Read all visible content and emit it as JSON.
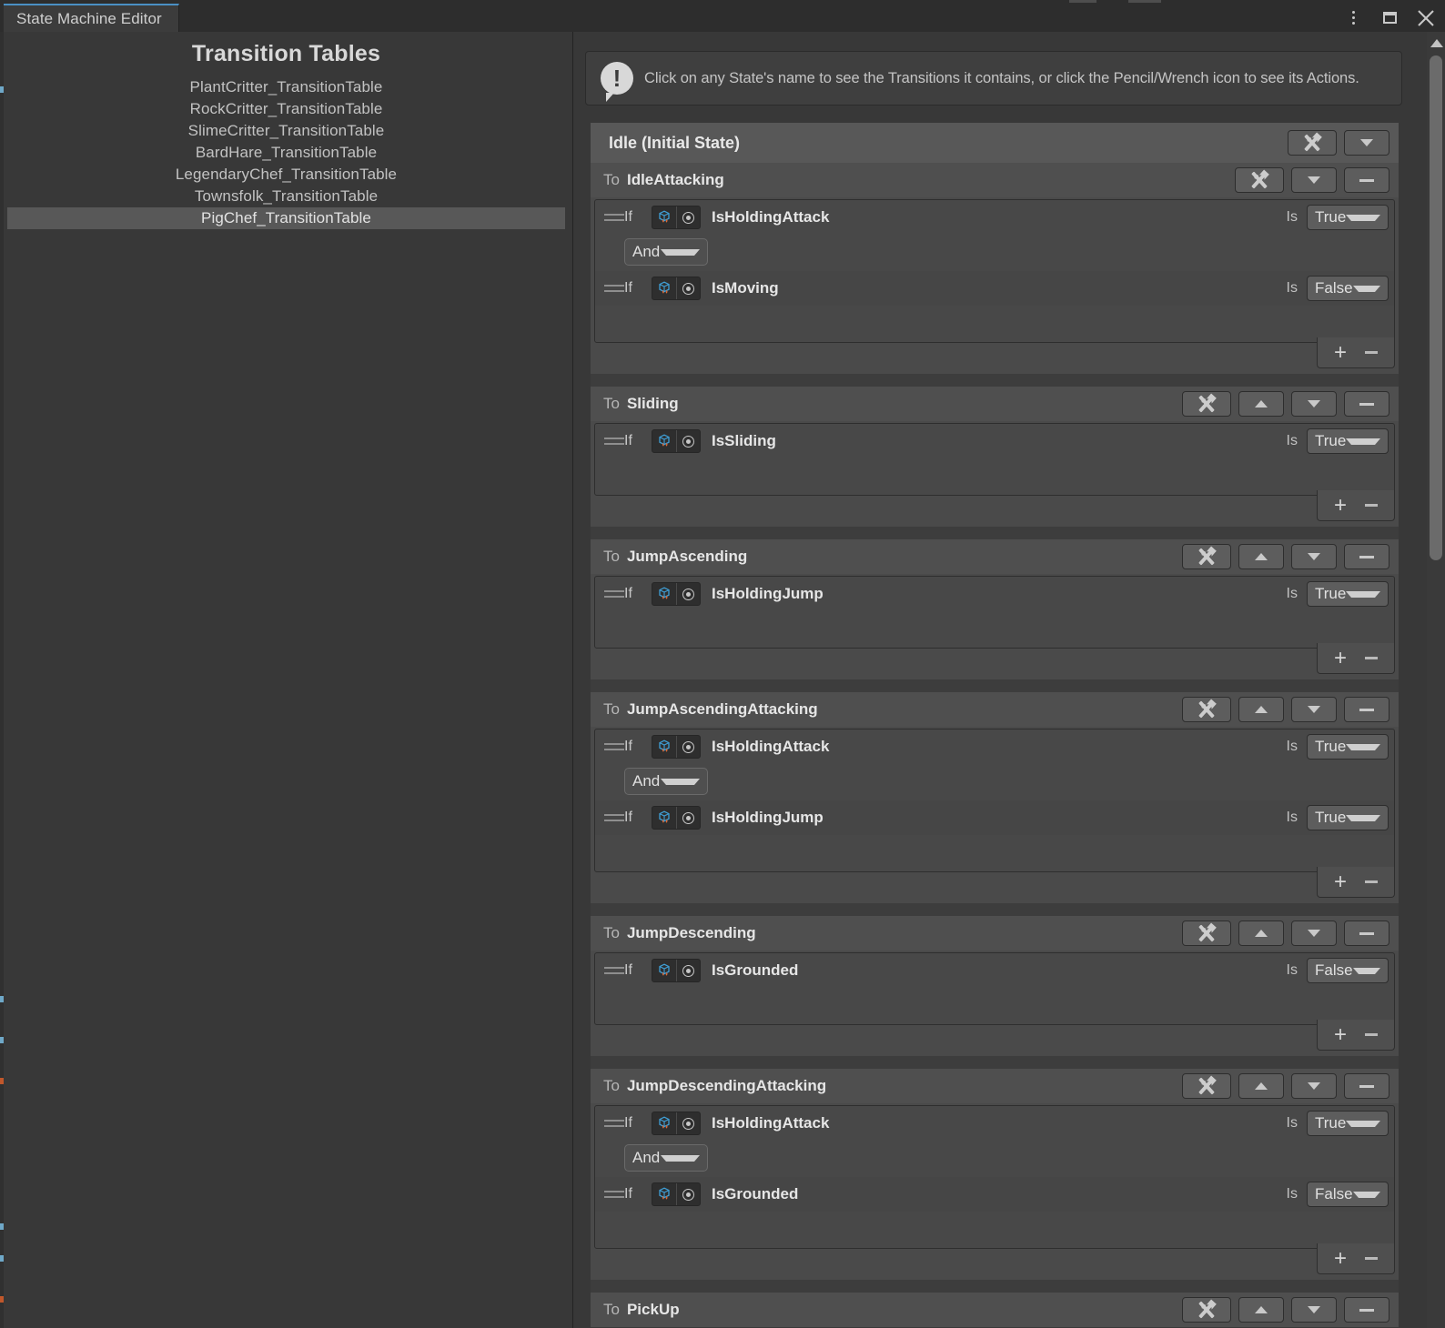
{
  "window": {
    "tab_label": "State Machine Editor",
    "buttons": [
      {
        "name": "overflow-menu",
        "icon": "kebab-menu-icon"
      },
      {
        "name": "maximize",
        "icon": "maximize-icon"
      },
      {
        "name": "close",
        "icon": "close-icon"
      }
    ],
    "accent_color": "#4a90c4"
  },
  "sidebar": {
    "title": "Transition Tables",
    "items": [
      {
        "label": "PlantCritter_TransitionTable",
        "selected": false
      },
      {
        "label": "RockCritter_TransitionTable",
        "selected": false
      },
      {
        "label": "SlimeCritter_TransitionTable",
        "selected": false
      },
      {
        "label": "BardHare_TransitionTable",
        "selected": false
      },
      {
        "label": "LegendaryChef_TransitionTable",
        "selected": false
      },
      {
        "label": "Townsfolk_TransitionTable",
        "selected": false
      },
      {
        "label": "PigChef_TransitionTable",
        "selected": true
      }
    ]
  },
  "info": {
    "icon": "info-exclamation-icon",
    "text": "Click on any State's name to see the Transitions it contains, or click the Pencil/Wrench icon to see its Actions."
  },
  "state": {
    "name": "Idle (Initial State)",
    "actions_button": "wrench-pencil-icon",
    "collapse_button": "chevron-down-icon"
  },
  "labels": {
    "to": "To",
    "if": "If",
    "is": "Is",
    "add": "+",
    "remove": "–",
    "asset_icon": "scriptable-object-icon",
    "picker_icon": "object-picker-icon",
    "drag_handle": "drag-handle-icon",
    "move_up": "move-up-icon",
    "move_down": "move-down-icon",
    "wrench": "wrench-pencil-icon"
  },
  "transitions": [
    {
      "target": "IdleAttacking",
      "has_move_up": false,
      "has_move_down": true,
      "conditions": [
        {
          "variable": "IsHoldingAttack",
          "value": "True"
        },
        {
          "variable": "IsMoving",
          "value": "False"
        }
      ],
      "operators": [
        "And"
      ]
    },
    {
      "target": "Sliding",
      "has_move_up": true,
      "has_move_down": true,
      "conditions": [
        {
          "variable": "IsSliding",
          "value": "True"
        }
      ],
      "operators": []
    },
    {
      "target": "JumpAscending",
      "has_move_up": true,
      "has_move_down": true,
      "conditions": [
        {
          "variable": "IsHoldingJump",
          "value": "True"
        }
      ],
      "operators": []
    },
    {
      "target": "JumpAscendingAttacking",
      "has_move_up": true,
      "has_move_down": true,
      "conditions": [
        {
          "variable": "IsHoldingAttack",
          "value": "True"
        },
        {
          "variable": "IsHoldingJump",
          "value": "True"
        }
      ],
      "operators": [
        "And"
      ]
    },
    {
      "target": "JumpDescending",
      "has_move_up": true,
      "has_move_down": true,
      "conditions": [
        {
          "variable": "IsGrounded",
          "value": "False"
        }
      ],
      "operators": []
    },
    {
      "target": "JumpDescendingAttacking",
      "has_move_up": true,
      "has_move_down": true,
      "conditions": [
        {
          "variable": "IsHoldingAttack",
          "value": "True"
        },
        {
          "variable": "IsGrounded",
          "value": "False"
        }
      ],
      "operators": [
        "And"
      ]
    },
    {
      "target": "PickUp",
      "has_move_up": true,
      "has_move_down": true,
      "conditions": [],
      "operators": [],
      "clipped": true
    }
  ],
  "scrollbar": {
    "up_arrow": "scroll-up-icon",
    "thumb_top_pct": 2,
    "thumb_height_pct": 39
  }
}
